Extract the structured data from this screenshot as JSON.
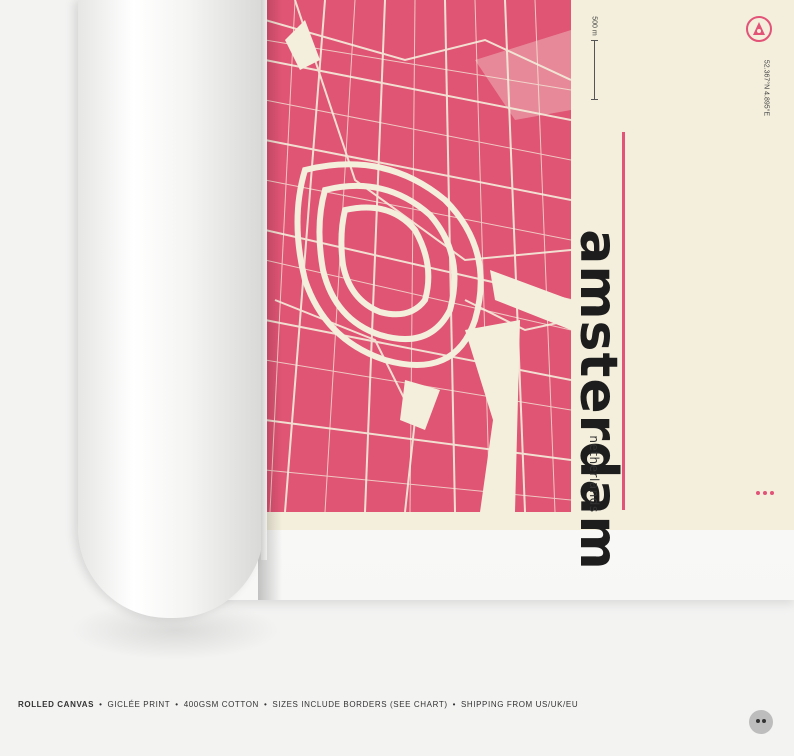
{
  "poster": {
    "title": "amsterdam",
    "subtitle": "netherlands",
    "scale_label": "500 m",
    "coordinates": "52.367°N 4.895°E",
    "accent_color": "#e25377",
    "map_color": "#e05474",
    "paper_color": "#f4efdd"
  },
  "caption": {
    "item1": "ROLLED CANVAS",
    "item2": "GICLÉE PRINT",
    "item3": "400GSM COTTON",
    "item4": "SIZES INCLUDE BORDERS (SEE CHART)",
    "item5": "SHIPPING FROM US/UK/EU",
    "separator": "•"
  },
  "icons": {
    "compass": "compass-icon",
    "badge": "owl-badge-icon"
  }
}
